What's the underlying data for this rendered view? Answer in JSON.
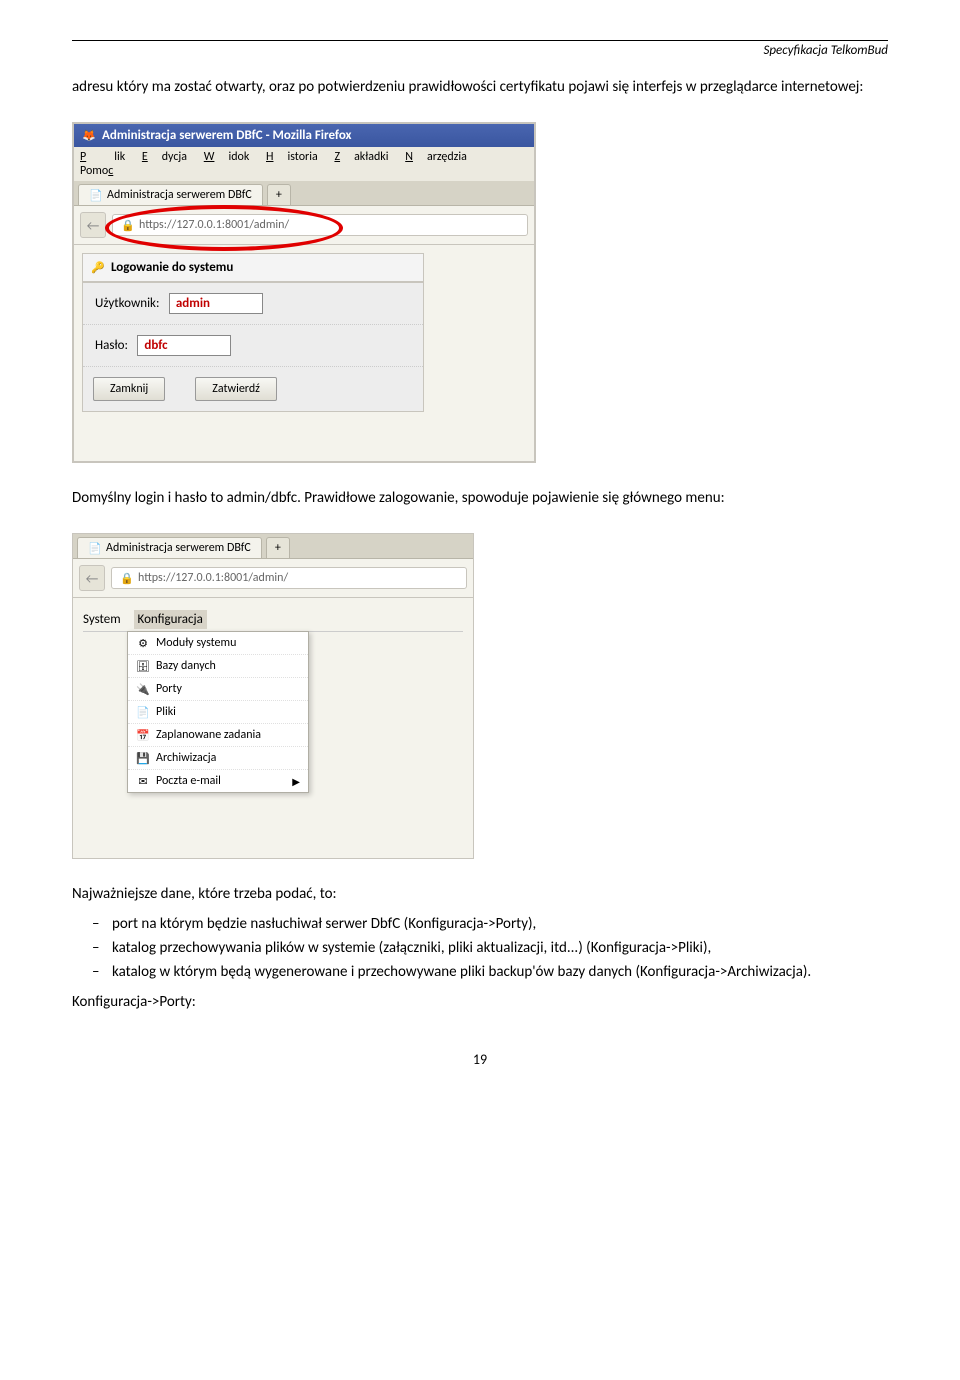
{
  "header": {
    "doc_title": "Specyfikacja TelkomBud"
  },
  "para1": "adresu który ma zostać otwarty, oraz po potwierdzeniu prawidłowości certyfikatu pojawi się interfejs w przeglądarce internetowej:",
  "shot1": {
    "title": "Administracja serwerem DBfC - Mozilla Firefox",
    "menu": {
      "plik": "Plik",
      "edycja": "Edycja",
      "widok": "Widok",
      "historia": "Historia",
      "zakladki": "Zakładki",
      "narzedzia": "Narzędzia",
      "pomoc": "Pomoc"
    },
    "tab": "Administracja serwerem DBfC",
    "plus": "+",
    "url": "https://127.0.0.1:8001/admin/",
    "panel_title": "Logowanie do systemu",
    "user_label": "Użytkownik:",
    "user_value": "admin",
    "pass_label": "Hasło:",
    "pass_value": "dbfc",
    "btn_close": "Zamknij",
    "btn_ok": "Zatwierdź"
  },
  "para2": "Domyślny login i hasło to admin/dbfc. Prawidłowe zalogowanie, spowoduje pojawienie się głównego menu:",
  "shot2": {
    "tab": "Administracja serwerem DBfC",
    "plus": "+",
    "url": "https://127.0.0.1:8001/admin/",
    "menu_system": "System",
    "menu_konfig": "Konfiguracja",
    "items": [
      "Moduły systemu",
      "Bazy danych",
      "Porty",
      "Pliki",
      "Zaplanowane zadania",
      "Archiwizacja",
      "Poczta e-mail"
    ]
  },
  "para3": "Najważniejsze dane, które trzeba podać, to:",
  "bullets": [
    "port na którym będzie nasłuchiwał serwer DbfC (Konfiguracja->Porty),",
    "katalog przechowywania plików w systemie (załączniki, pliki aktualizacji, itd...) (Konfiguracja->Pliki),",
    "katalog w którym będą wygenerowane i przechowywane pliki backup'ów bazy danych (Konfiguracja->Archiwizacja)."
  ],
  "para4": "Konfiguracja->Porty:",
  "page_number": "19"
}
